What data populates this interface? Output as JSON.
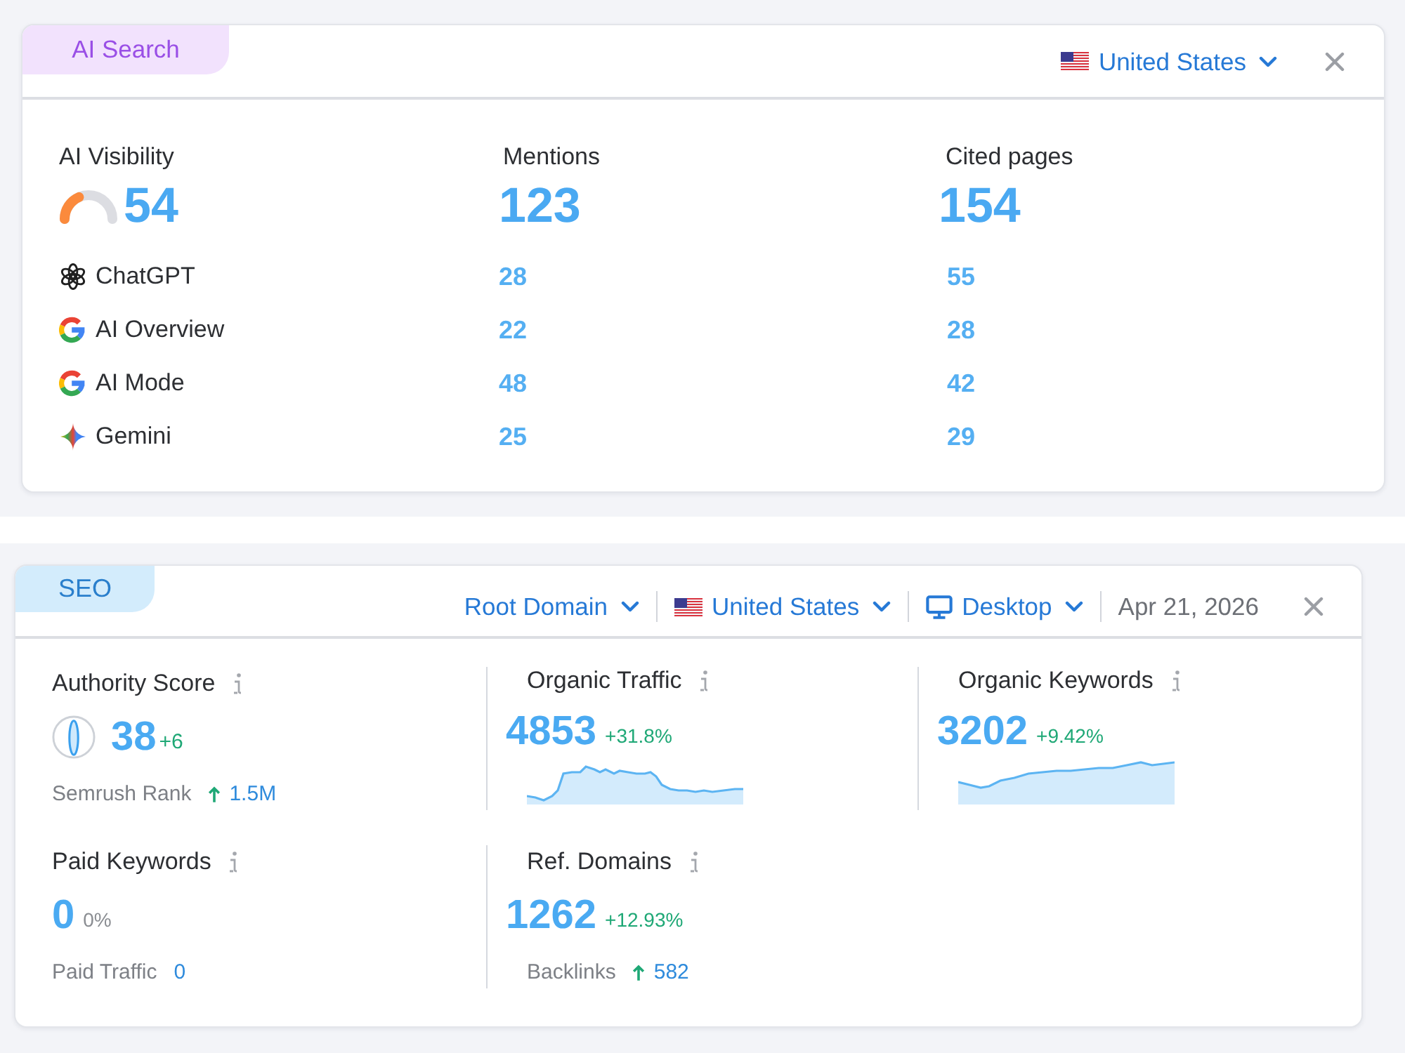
{
  "ai_search": {
    "tab": "AI Search",
    "country": "United States",
    "summary": [
      {
        "kind": "gauge",
        "label": "AI Visibility",
        "value": "54",
        "level": 0.3
      },
      {
        "kind": "plain",
        "label": "Mentions",
        "value": "123"
      },
      {
        "kind": "plain",
        "label": "Cited pages",
        "value": "154"
      }
    ],
    "platforms": [
      {
        "kind": "chatgpt",
        "name": "ChatGPT",
        "mentions": "28",
        "cited_pages": "55"
      },
      {
        "kind": "google",
        "name": "AI Overview",
        "mentions": "22",
        "cited_pages": "28"
      },
      {
        "kind": "google",
        "name": "AI Mode",
        "mentions": "48",
        "cited_pages": "42"
      },
      {
        "kind": "gemini",
        "name": "Gemini",
        "mentions": "25",
        "cited_pages": "29"
      }
    ]
  },
  "seo": {
    "tab": "SEO",
    "filters": [
      {
        "kind": "scope",
        "label": "Root Domain"
      },
      {
        "kind": "country",
        "label": "United States"
      },
      {
        "kind": "device",
        "label": "Desktop"
      }
    ],
    "date": "Apr 21, 2026",
    "metrics": [
      {
        "kind": "score",
        "label": "Authority Score",
        "value": "38",
        "change": "+6",
        "rising": true,
        "sub_label": "Semrush Rank",
        "sub_value": "1.5M",
        "sub_rising": true
      },
      {
        "kind": "trend",
        "label": "Organic Traffic",
        "value": "4853",
        "change": "+31.8%",
        "rising": true
      },
      {
        "kind": "trend",
        "label": "Organic Keywords",
        "value": "3202",
        "change": "+9.42%",
        "rising": true
      },
      {
        "kind": "detail",
        "label": "Paid Keywords",
        "value": "0",
        "change": "0%",
        "rising": false,
        "sub_label": "Paid Traffic",
        "sub_value": "0",
        "sub_rising": false
      },
      {
        "kind": "detail",
        "label": "Ref. Domains",
        "value": "1262",
        "change": "+12.93%",
        "rising": true,
        "sub_label": "Backlinks",
        "sub_value": "582",
        "sub_rising": true
      }
    ]
  }
}
